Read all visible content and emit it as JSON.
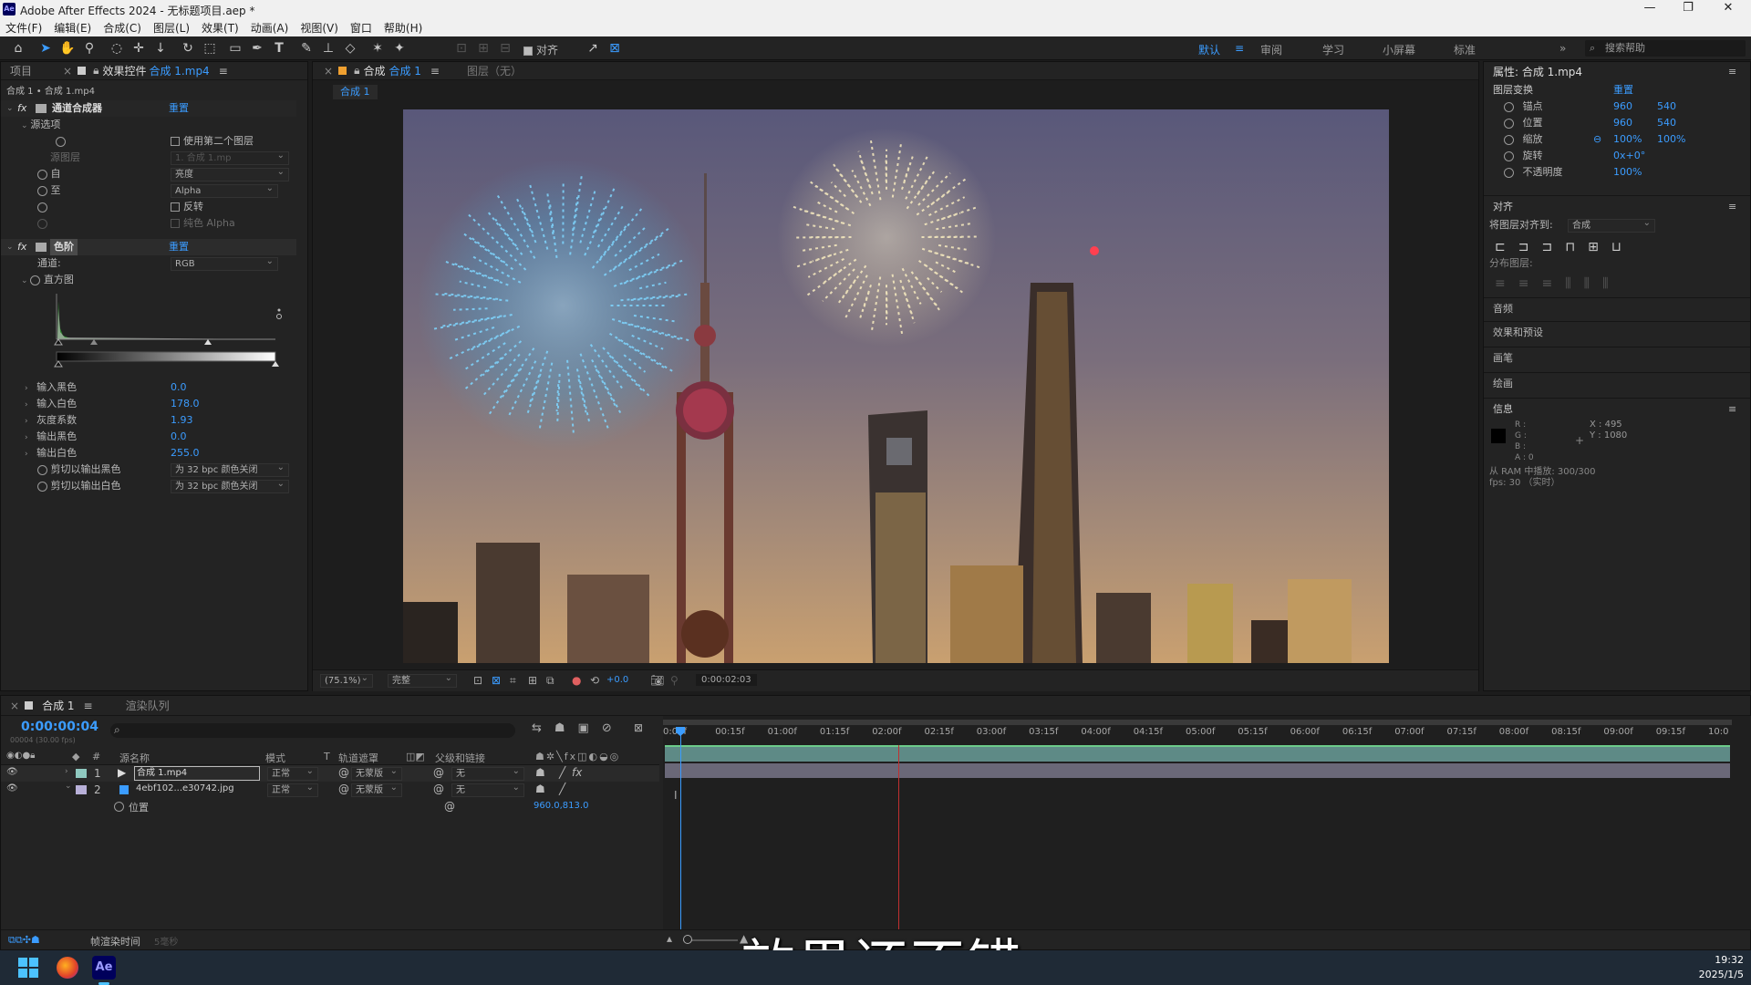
{
  "window": {
    "title": "Adobe After Effects 2024 - 无标题项目.aep *",
    "logo": "Ae",
    "controls": [
      "minimize-icon",
      "restore-icon",
      "close-icon"
    ]
  },
  "menu": [
    "文件(F)",
    "编辑(E)",
    "合成(C)",
    "图层(L)",
    "效果(T)",
    "动画(A)",
    "视图(V)",
    "窗口",
    "帮助(H)"
  ],
  "toolbar": {
    "align_label": "对齐",
    "workspaces": [
      "默认",
      "审阅",
      "学习",
      "小屏幕",
      "标准"
    ],
    "search_placeholder": "搜索帮助",
    "accent": "#3b9cff"
  },
  "left_panel": {
    "tab_project": "项目",
    "tab_effects": "效果控件",
    "tab_effects_target": "合成 1.mp4",
    "breadcrumb": "合成 1 • 合成 1.mp4",
    "effect1": {
      "name": "通道合成器",
      "reset": "重置",
      "source_options": "源选项",
      "use_second_layer": "使用第二个图层",
      "source_layer_label": "源图层",
      "source_layer_value": "1. 合成 1.mp",
      "from_label": "自",
      "from_value": "亮度",
      "to_label": "至",
      "to_value": "Alpha",
      "invert": "反转",
      "solid_alpha": "纯色 Alpha"
    },
    "effect2": {
      "name": "色阶",
      "reset": "重置",
      "channel_label": "通道:",
      "channel_value": "RGB",
      "histogram_label": "直方图",
      "props": [
        {
          "label": "输入黑色",
          "value": "0.0"
        },
        {
          "label": "输入白色",
          "value": "178.0"
        },
        {
          "label": "灰度系数",
          "value": "1.93"
        },
        {
          "label": "输出黑色",
          "value": "0.0"
        },
        {
          "label": "输出白色",
          "value": "255.0"
        }
      ],
      "clip_black_label": "剪切以输出黑色",
      "clip_black_value": "为 32 bpc 颜色关闭",
      "clip_white_label": "剪切以输出白色",
      "clip_white_value": "为 32 bpc 颜色关闭"
    }
  },
  "viewer": {
    "tab_comp": "合成",
    "tab_comp_name": "合成 1",
    "tab_layer": "图层（无）",
    "breadcrumb": "合成 1",
    "zoom": "(75.1%)",
    "quality": "完整",
    "exposure": "+0.0",
    "timecode": "0:00:02:03"
  },
  "right_panel": {
    "properties_title": "属性: 合成 1.mp4",
    "layer_transform": "图层变换",
    "reset": "重置",
    "props": [
      {
        "label": "锚点",
        "v1": "960",
        "v2": "540"
      },
      {
        "label": "位置",
        "v1": "960",
        "v2": "540"
      },
      {
        "label": "缩放",
        "v1": "100%",
        "v2": "100%"
      },
      {
        "label": "旋转",
        "v1": "0x+0°",
        "v2": ""
      },
      {
        "label": "不透明度",
        "v1": "100%",
        "v2": ""
      }
    ],
    "align_title": "对齐",
    "align_to_label": "将图层对齐到:",
    "align_to_value": "合成",
    "distribute_label": "分布图层:",
    "sections": [
      "音频",
      "效果和预设",
      "画笔",
      "绘画"
    ],
    "info_title": "信息",
    "info_rgb": [
      "R :",
      "G :",
      "B :",
      "A : 0"
    ],
    "info_x": "X : 495",
    "info_y": "Y : 1080",
    "ram_line": "从 RAM 中播放: 300/300",
    "fps_line": "fps: 30 （实时）"
  },
  "timeline": {
    "tab_comp": "合成 1",
    "tab_render": "渲染队列",
    "timecode": "0:00:00:04",
    "timecode_sub": "00004 (30.00 fps)",
    "col_source": "源名称",
    "col_mode": "模式",
    "col_t": "T",
    "col_track": "轨道遮罩",
    "col_parent": "父级和链接",
    "num_header": "#",
    "layers": [
      {
        "num": "1",
        "name": "合成 1.mp4",
        "mode": "正常",
        "track": "无蒙版",
        "parent": "无"
      },
      {
        "num": "2",
        "name": "4ebf102...e30742.jpg",
        "mode": "正常",
        "track": "无蒙版",
        "parent": "无"
      }
    ],
    "sub_prop_label": "位置",
    "sub_prop_value": "960.0,813.0",
    "ruler": [
      "0:00f",
      "00:15f",
      "01:00f",
      "01:15f",
      "02:00f",
      "02:15f",
      "03:00f",
      "03:15f",
      "04:00f",
      "04:15f",
      "05:00f",
      "05:15f",
      "06:00f",
      "06:15f",
      "07:00f",
      "07:15f",
      "08:00f",
      "08:15f",
      "09:00f",
      "09:15f",
      "10:0"
    ],
    "footer_label": "帧渲染时间",
    "footer_value": "5毫秒"
  },
  "subtitle": "效果还不错",
  "taskbar": {
    "time": "19:32",
    "date": "2025/1/5",
    "app_label": "Ae"
  }
}
